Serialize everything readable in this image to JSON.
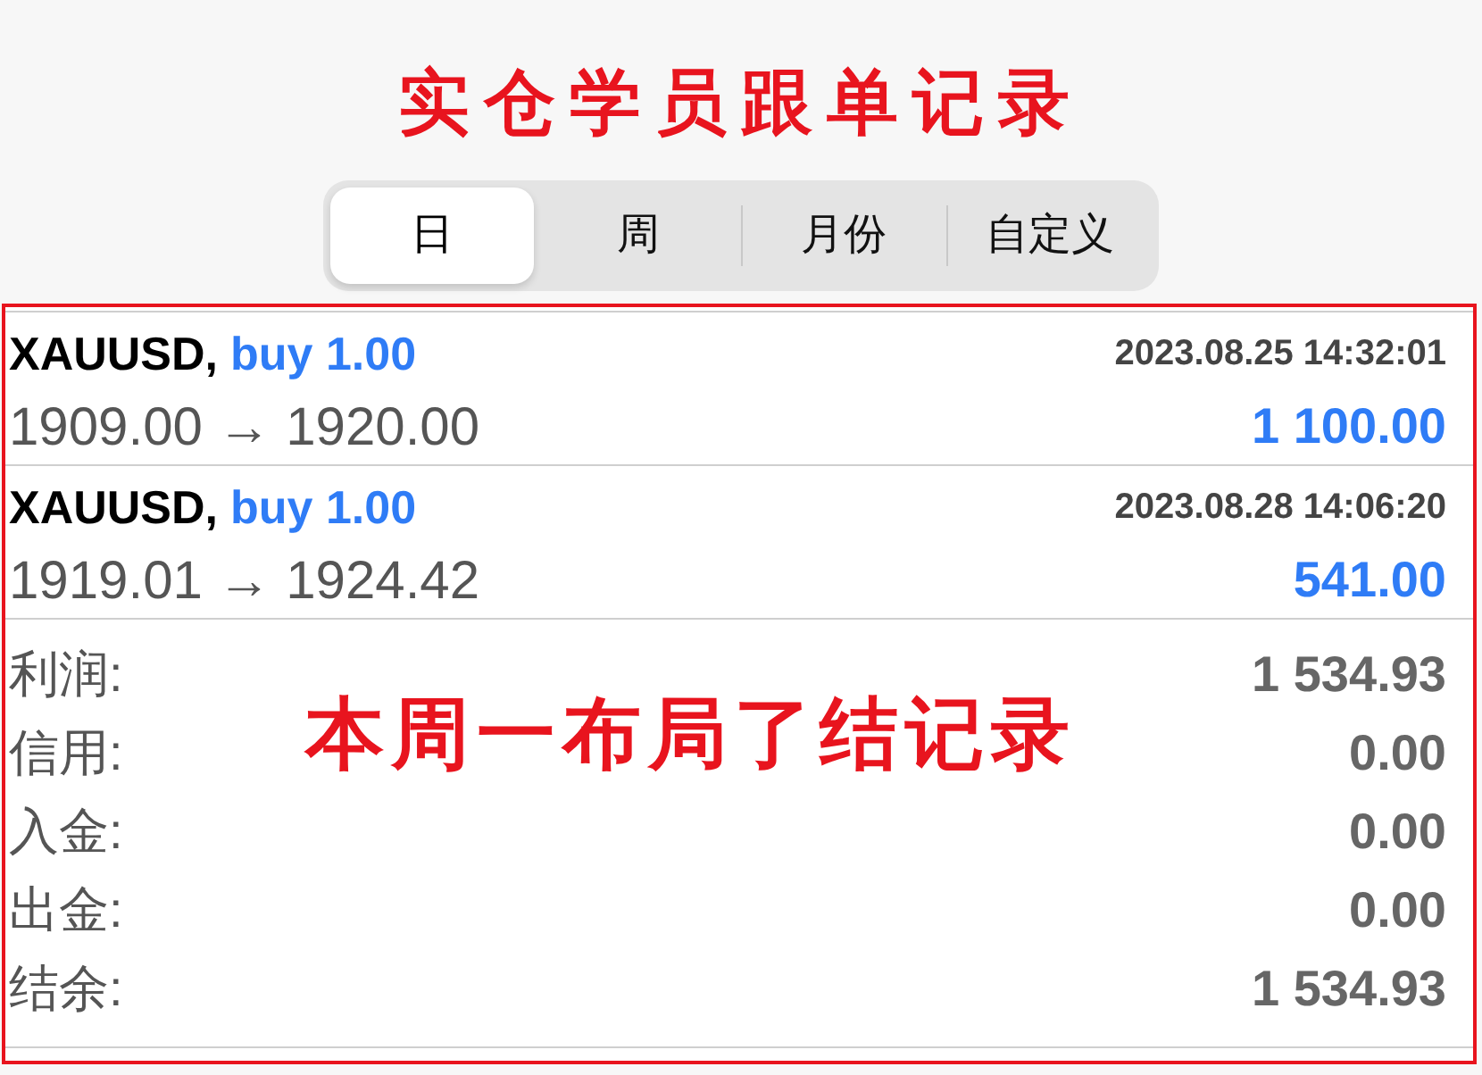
{
  "title": "实仓学员跟单记录",
  "tabs": [
    {
      "label": "日",
      "selected": true
    },
    {
      "label": "周",
      "selected": false
    },
    {
      "label": "月份",
      "selected": false
    },
    {
      "label": "自定义",
      "selected": false
    }
  ],
  "deals": [
    {
      "symbol": "XAUUSD,",
      "action": "buy 1.00",
      "time": "2023.08.25 14:32:01",
      "prices": "1909.00 → 1920.00",
      "profit": "1 100.00"
    },
    {
      "symbol": "XAUUSD,",
      "action": "buy 1.00",
      "time": "2023.08.28 14:06:20",
      "prices": "1919.01 → 1924.42",
      "profit": "541.00"
    }
  ],
  "summary": [
    {
      "label": "利润:",
      "value": "1 534.93"
    },
    {
      "label": "信用:",
      "value": "0.00"
    },
    {
      "label": "入金:",
      "value": "0.00"
    },
    {
      "label": "出金:",
      "value": "0.00"
    },
    {
      "label": "结余:",
      "value": "1 534.93"
    }
  ],
  "annotation": "本周一布局了结记录"
}
